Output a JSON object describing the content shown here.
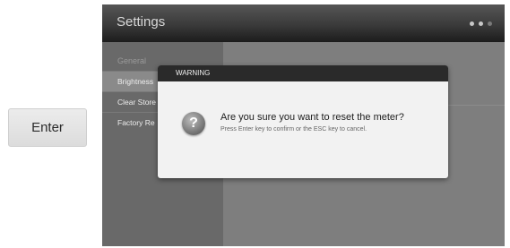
{
  "enter_button": {
    "label": "Enter"
  },
  "settings": {
    "title": "Settings",
    "pager": {
      "pages": 3,
      "current": 1
    },
    "menu": {
      "group_label": "General",
      "items": [
        {
          "label": "Brightness"
        },
        {
          "label": "Clear Store"
        },
        {
          "label": "Factory Re"
        }
      ]
    }
  },
  "dialog": {
    "header": "WARNING",
    "icon": "question-icon",
    "icon_glyph": "?",
    "message": "Are you sure you want to reset the meter?",
    "hint": "Press Enter key to confirm or the ESC key to cancel."
  }
}
